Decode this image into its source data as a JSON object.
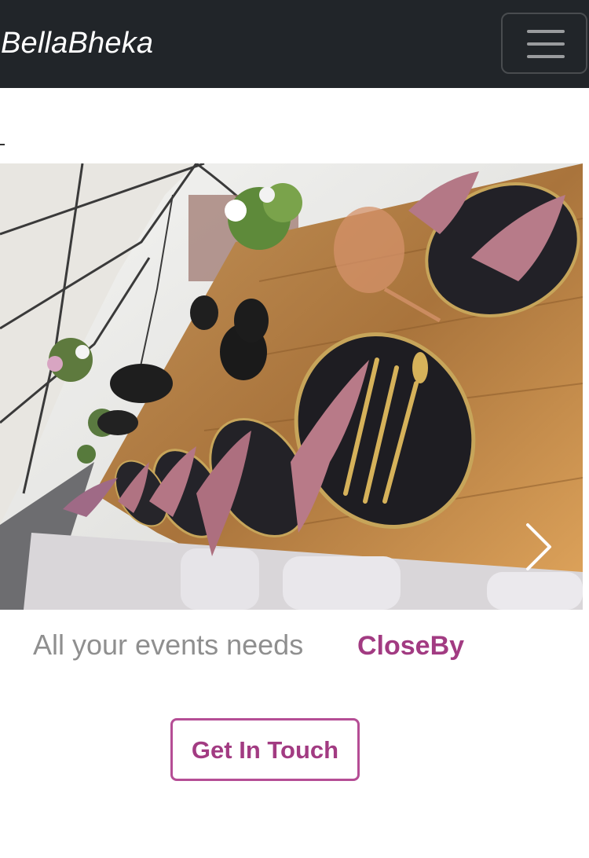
{
  "navbar": {
    "brand": "BellaBheka",
    "toggler_icon": "hamburger-menu-icon"
  },
  "hero": {
    "image_subject": "outdoor event table setting with pink napkins and gold cutlery under a tent",
    "next_icon": "chevron-right-icon"
  },
  "tagline": {
    "text": "All your events needs",
    "accent": "CloseBy"
  },
  "cta": {
    "label": "Get In Touch"
  },
  "colors": {
    "navbar_bg": "#212529",
    "accent": "#a23b82",
    "tagline_gray": "#8f8f8f"
  }
}
